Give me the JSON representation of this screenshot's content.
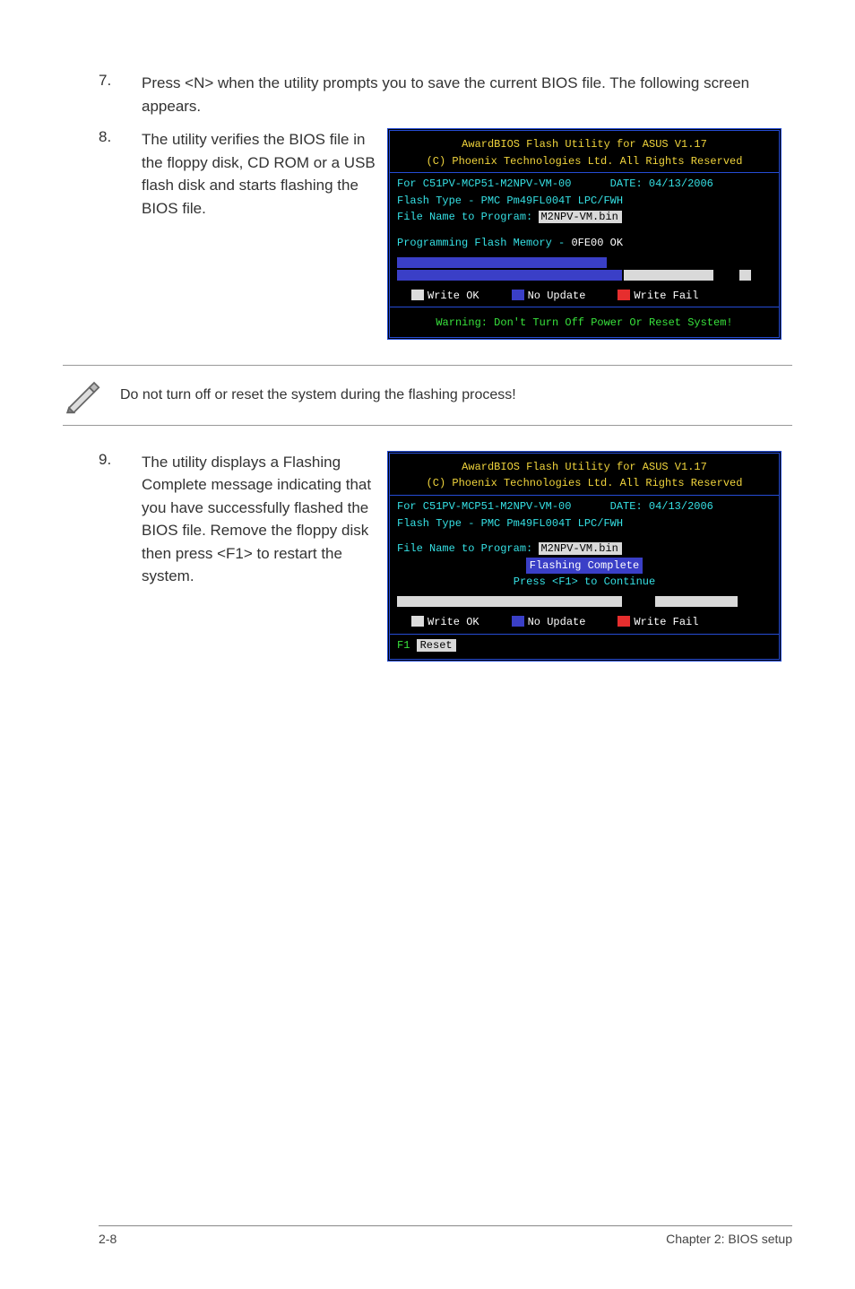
{
  "step7": {
    "num": "7.",
    "text": "Press <N> when the utility prompts you to save the current BIOS file. The following screen appears."
  },
  "step8": {
    "num": "8.",
    "text": "The utility verifies the BIOS file in the floppy disk, CD ROM or a USB flash disk and starts flashing the BIOS file."
  },
  "step9": {
    "num": "9.",
    "text": "The utility displays a Flashing Complete message indicating that you have successfully flashed the BIOS file. Remove the floppy disk then press <F1> to restart the system."
  },
  "note": {
    "text": "Do not turn off or reset the system during the flashing process!"
  },
  "bios1": {
    "title": "AwardBIOS Flash Utility for ASUS V1.17",
    "subtitle": "(C) Phoenix Technologies Ltd. All Rights Reserved",
    "for_line_left": "For C51PV-MCP51-M2NPV-VM-00",
    "for_line_right": "DATE: 04/13/2006",
    "flash_type": "Flash Type - PMC Pm49FL004T LPC/FWH",
    "file_name_label": "File Name to Program:",
    "file_name_value": "M2NPV-VM.bin",
    "programming_label": "Programming Flash Memory -",
    "programming_value": "0FE00 OK",
    "legend_ok": "Write OK",
    "legend_noup": "No Update",
    "legend_fail": "Write Fail",
    "warning": "Warning: Don't Turn Off Power Or Reset System!"
  },
  "bios2": {
    "title": "AwardBIOS Flash Utility for ASUS V1.17",
    "subtitle": "(C) Phoenix Technologies Ltd. All Rights Reserved",
    "for_line_left": "For C51PV-MCP51-M2NPV-VM-00",
    "for_line_right": "DATE: 04/13/2006",
    "flash_type": "Flash Type - PMC Pm49FL004T LPC/FWH",
    "file_name_label": "File Name to Program:",
    "file_name_value": "M2NPV-VM.bin",
    "flashing_complete": "Flashing Complete",
    "press_f1": "Press <F1> to Continue",
    "legend_ok": "Write OK",
    "legend_noup": "No Update",
    "legend_fail": "Write Fail",
    "f1_label": "F1",
    "reset_label": "Reset"
  },
  "footer": {
    "left": "2-8",
    "right": "Chapter 2: BIOS setup"
  }
}
